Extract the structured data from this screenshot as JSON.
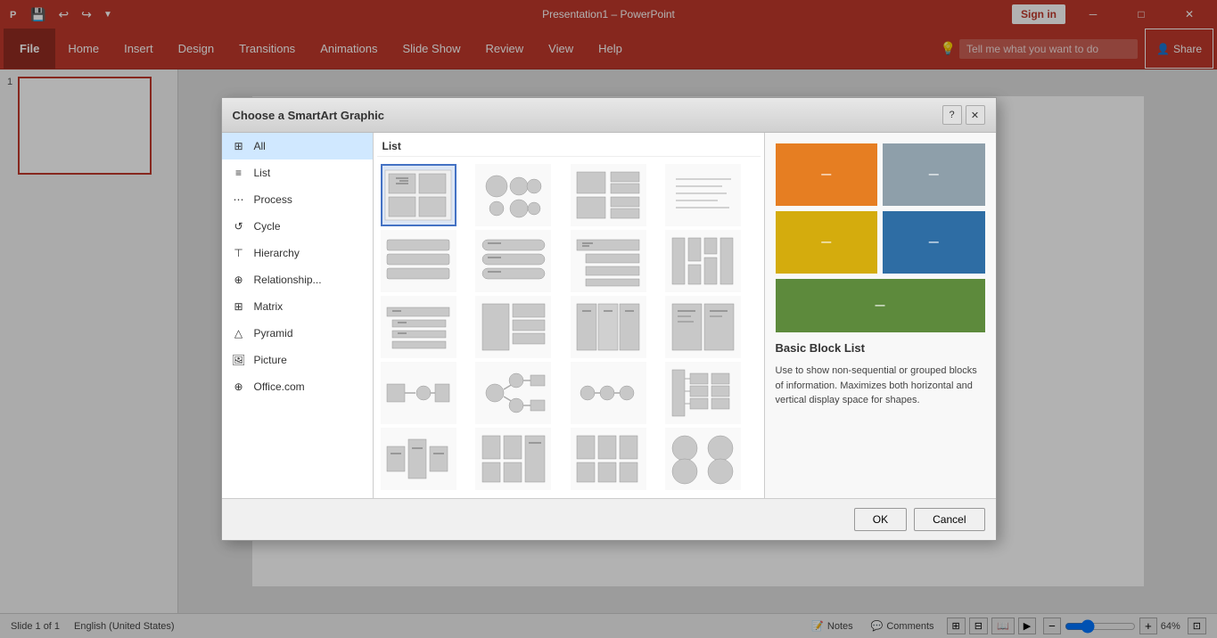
{
  "titleBar": {
    "appName": "Presentation1 – PowerPoint",
    "signInLabel": "Sign in",
    "minimizeIcon": "─",
    "restoreIcon": "□",
    "closeIcon": "✕"
  },
  "ribbon": {
    "tabs": [
      {
        "id": "file",
        "label": "File"
      },
      {
        "id": "home",
        "label": "Home"
      },
      {
        "id": "insert",
        "label": "Insert"
      },
      {
        "id": "design",
        "label": "Design"
      },
      {
        "id": "transitions",
        "label": "Transitions"
      },
      {
        "id": "animations",
        "label": "Animations"
      },
      {
        "id": "slideshow",
        "label": "Slide Show"
      },
      {
        "id": "review",
        "label": "Review"
      },
      {
        "id": "view",
        "label": "View"
      },
      {
        "id": "help",
        "label": "Help"
      }
    ],
    "searchPlaceholder": "Tell me what you want to do",
    "shareLabel": "Share"
  },
  "dialog": {
    "title": "Choose a SmartArt Graphic",
    "helpIcon": "?",
    "closeIcon": "✕",
    "graphicsHeader": "List",
    "categories": [
      {
        "id": "all",
        "label": "All",
        "icon": "⊞"
      },
      {
        "id": "list",
        "label": "List",
        "icon": "≡"
      },
      {
        "id": "process",
        "label": "Process",
        "icon": "⋯"
      },
      {
        "id": "cycle",
        "label": "Cycle",
        "icon": "↺"
      },
      {
        "id": "hierarchy",
        "label": "Hierarchy",
        "icon": "⊤"
      },
      {
        "id": "relationship",
        "label": "Relationship...",
        "icon": "⊕"
      },
      {
        "id": "matrix",
        "label": "Matrix",
        "icon": "⊞"
      },
      {
        "id": "pyramid",
        "label": "Pyramid",
        "icon": "△"
      },
      {
        "id": "picture",
        "label": "Picture",
        "icon": "🖼"
      },
      {
        "id": "office",
        "label": "Office.com",
        "icon": "⊕"
      }
    ],
    "preview": {
      "title": "Basic Block List",
      "description": "Use to show non-sequential or grouped blocks of information. Maximizes both horizontal and vertical display space for shapes."
    },
    "okLabel": "OK",
    "cancelLabel": "Cancel"
  },
  "statusBar": {
    "slideInfo": "Slide 1 of 1",
    "language": "English (United States)",
    "notesLabel": "Notes",
    "commentsLabel": "Comments",
    "zoomLevel": "64%"
  }
}
